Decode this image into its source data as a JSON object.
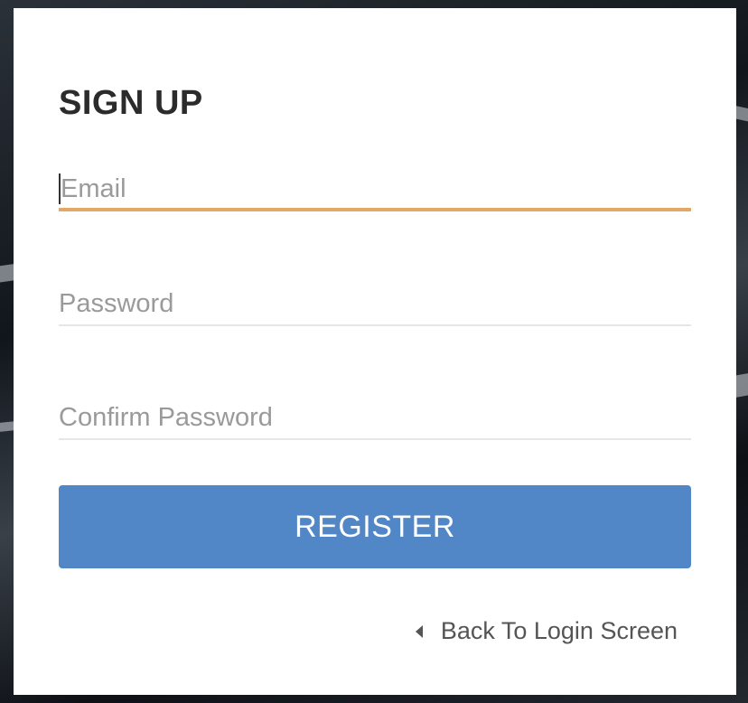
{
  "form": {
    "title": "SIGN UP",
    "email": {
      "placeholder": "Email",
      "value": ""
    },
    "password": {
      "placeholder": "Password",
      "value": ""
    },
    "confirm_password": {
      "placeholder": "Confirm Password",
      "value": ""
    },
    "register_label": "REGISTER",
    "back_link_label": "Back To Login Screen",
    "back_icon": "caret-left-icon"
  },
  "colors": {
    "accent_focus": "#e4a866",
    "primary_button": "#5186c7",
    "card_background": "#ffffff"
  }
}
